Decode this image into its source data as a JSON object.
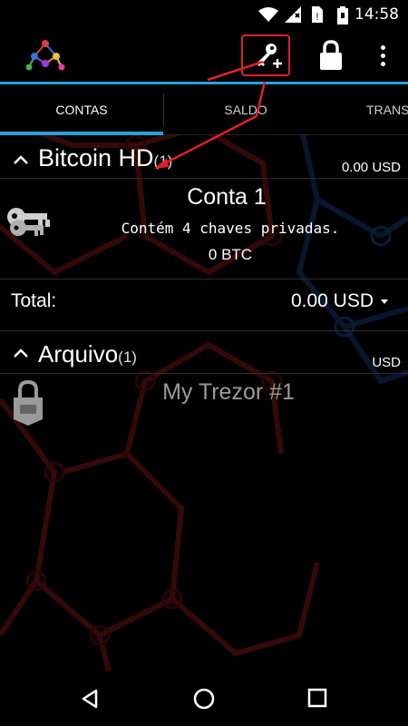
{
  "status_bar": {
    "time": "14:58",
    "icons": [
      "wifi-icon",
      "signal-icon",
      "no-sim-icon",
      "battery-icon"
    ]
  },
  "app_bar": {
    "logo": "mycelium-logo-icon",
    "actions": [
      "add-key-icon",
      "lock-icon",
      "overflow-menu-icon"
    ]
  },
  "tabs": [
    {
      "label": "CONTAS",
      "selected": true
    },
    {
      "label": "SALDO",
      "selected": false
    },
    {
      "label": "TRANS",
      "selected": false
    }
  ],
  "sections": {
    "bitcoin_hd": {
      "title": "Bitcoin HD",
      "count": "(1)",
      "amount": "0.00 USD"
    },
    "account": {
      "name": "Conta 1",
      "keys_text": "Contém 4 chaves privadas.",
      "balance": "0 BTC"
    },
    "total": {
      "label": "Total:",
      "value": "0.00 USD"
    },
    "archive": {
      "title": "Arquivo",
      "count": "(1)",
      "amount": "USD"
    },
    "trezor": {
      "name": "My Trezor #1"
    }
  },
  "colors": {
    "accent": "#2aa1dc",
    "annotation": "#e0202a",
    "background": "#000000"
  },
  "nav_bar": {
    "icons": [
      "back-icon",
      "home-icon",
      "recents-icon"
    ]
  }
}
